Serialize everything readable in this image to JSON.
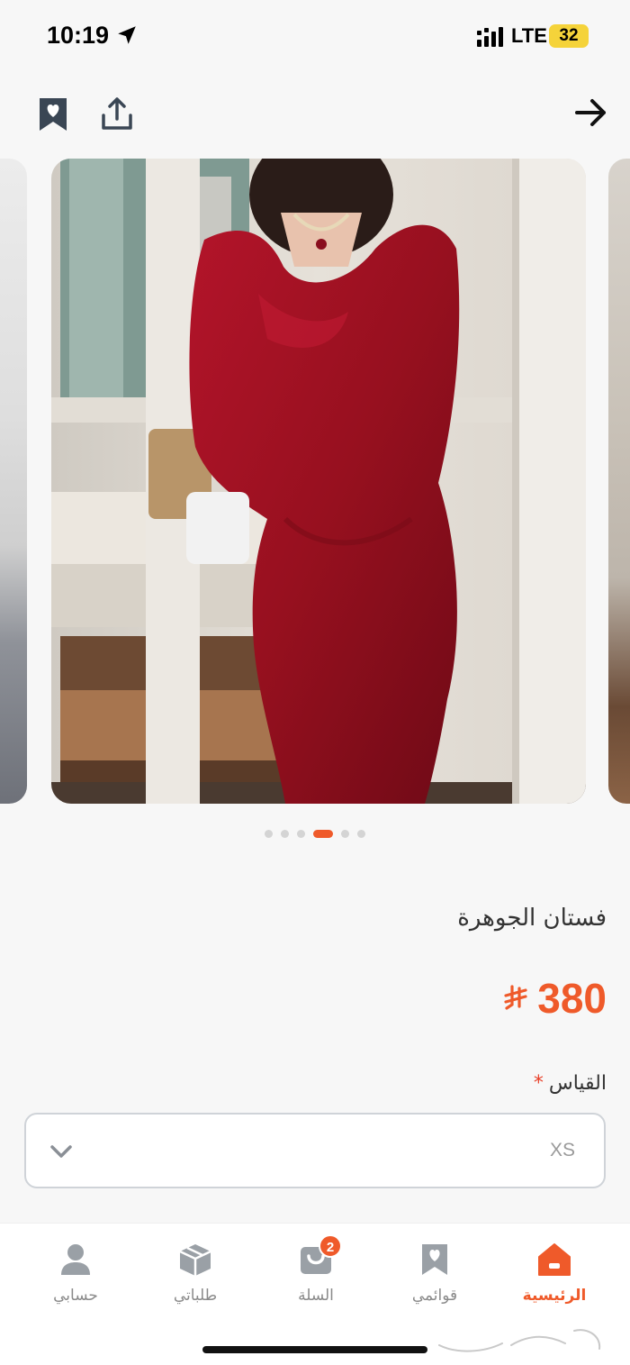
{
  "status_bar": {
    "time": "10:19",
    "network": "LTE",
    "battery": "32",
    "location_icon": "location-arrow-icon",
    "signal_icon": "signal-bars-icon"
  },
  "toolbar": {
    "bookmark_icon": "bookmark-heart-icon",
    "share_icon": "share-icon",
    "back_icon": "arrow-right-icon"
  },
  "gallery": {
    "image_count": 6,
    "active_index": 3,
    "image_description": "red lace dress photo"
  },
  "product": {
    "title": "فستان الجوهرة",
    "price": "380",
    "currency_icon": "riyal-symbol-icon"
  },
  "size": {
    "label": "القياس",
    "required_marker": "*",
    "selected_value": "XS",
    "dropdown_icon": "chevron-down-icon"
  },
  "tabbar": {
    "items": [
      {
        "label": "الرئيسية",
        "icon": "home-icon",
        "active": true
      },
      {
        "label": "قوائمي",
        "icon": "bookmark-heart-icon",
        "active": false
      },
      {
        "label": "السلة",
        "icon": "cart-icon",
        "active": false,
        "badge": "2"
      },
      {
        "label": "طلباتي",
        "icon": "box-icon",
        "active": false
      },
      {
        "label": "حسابي",
        "icon": "user-icon",
        "active": false
      }
    ]
  },
  "colors": {
    "accent": "#ef5a2a",
    "background": "#f7f7f7",
    "dress": "#a8121f"
  },
  "watermark": "haraj-logo"
}
